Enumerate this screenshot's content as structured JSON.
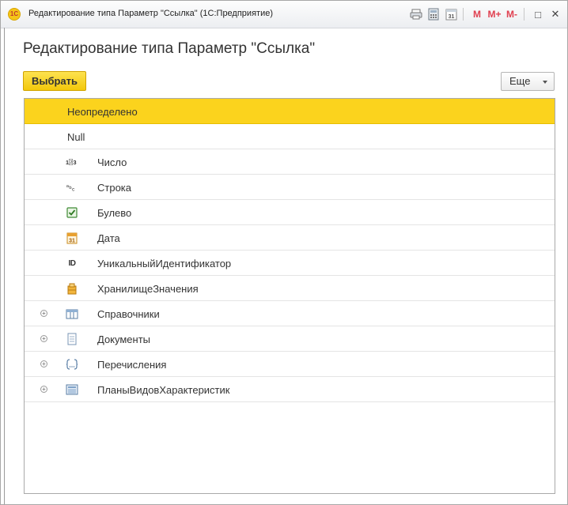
{
  "window": {
    "logo_text": "1С",
    "title": "Редактирование типа Параметр \"Ссылка\"  (1С:Предприятие)",
    "tb_m": "M",
    "tb_m_plus": "M+",
    "tb_m_minus": "M-",
    "tb_restore": "□",
    "tb_close": "✕"
  },
  "form": {
    "title": "Редактирование типа Параметр \"Ссылка\""
  },
  "command_bar": {
    "select_label": "Выбрать",
    "more_label": "Еще"
  },
  "types": [
    {
      "label": "Неопределено",
      "icon": "none",
      "selected": true
    },
    {
      "label": "Null",
      "icon": "none"
    },
    {
      "label": "Число",
      "icon": "number-icon",
      "icon_text": "1₂3"
    },
    {
      "label": "Строка",
      "icon": "string-icon",
      "icon_text": "ᵃb꜀"
    },
    {
      "label": "Булево",
      "icon": "checkbox-icon"
    },
    {
      "label": "Дата",
      "icon": "calendar-icon",
      "icon_text": "31"
    },
    {
      "label": "УникальныйИдентификатор",
      "icon": "id-icon",
      "icon_text": "ID"
    },
    {
      "label": "ХранилищеЗначения",
      "icon": "storage-icon"
    },
    {
      "label": "Справочники",
      "icon": "catalog-icon",
      "expandable": true
    },
    {
      "label": "Документы",
      "icon": "document-icon",
      "expandable": true
    },
    {
      "label": "Перечисления",
      "icon": "enum-icon",
      "icon_text": "{...}",
      "expandable": true
    },
    {
      "label": "ПланыВидовХарактеристик",
      "icon": "chart-of-characteristics-icon",
      "expandable": true
    }
  ],
  "colors": {
    "accent": "#fbd31d",
    "button_border": "#d0a300"
  }
}
